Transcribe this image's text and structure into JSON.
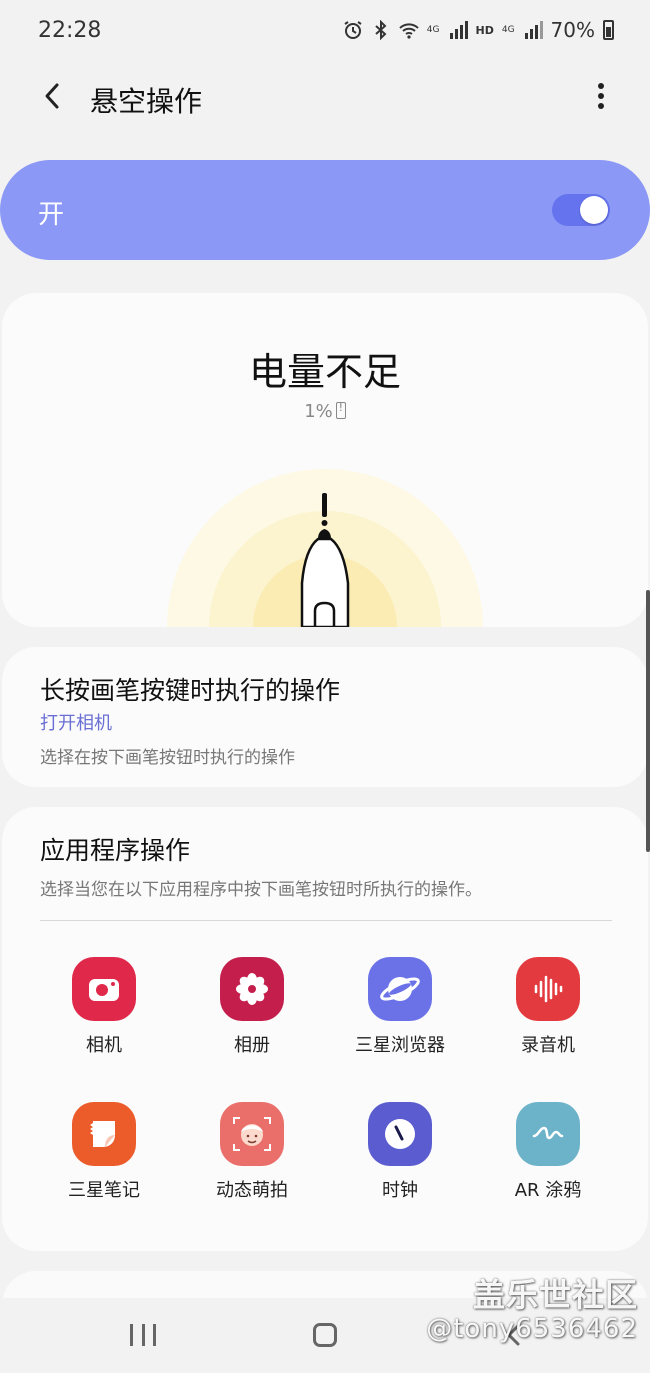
{
  "status_bar": {
    "time": "22:28",
    "network_1": "4G",
    "hd": "HD",
    "network_2": "4G",
    "battery": "70%"
  },
  "app_bar": {
    "title": "悬空操作"
  },
  "master_switch": {
    "label": "开",
    "state": "on",
    "accent": "#8b98f6"
  },
  "pen_battery": {
    "headline": "电量不足",
    "level": "1%"
  },
  "press_action": {
    "title": "长按画笔按键时执行的操作",
    "value": "打开相机",
    "description": "选择在按下画笔按钮时执行的操作"
  },
  "app_actions": {
    "title": "应用程序操作",
    "description": "选择当您在以下应用程序中按下画笔按钮时所执行的操作。",
    "apps": [
      {
        "name": "相机",
        "icon": "camera-icon",
        "color": "#e0284a"
      },
      {
        "name": "相册",
        "icon": "gallery-flower-icon",
        "color": "#c41e4d"
      },
      {
        "name": "三星浏览器",
        "icon": "browser-planet-icon",
        "color": "#6b72e8"
      },
      {
        "name": "录音机",
        "icon": "voice-wave-icon",
        "color": "#e33a3f"
      },
      {
        "name": "三星笔记",
        "icon": "notes-icon",
        "color": "#ec5b2a"
      },
      {
        "name": "动态萌拍",
        "icon": "ar-emoji-face-icon",
        "color": "#ea6e6a"
      },
      {
        "name": "时钟",
        "icon": "clock-icon",
        "color": "#5a5ccf"
      },
      {
        "name": "AR 涂鸦",
        "icon": "ar-doodle-icon",
        "color": "#6cb3c9"
      }
    ]
  },
  "watermark": {
    "line1": "盖乐世社区",
    "line2": "@tony6536462"
  }
}
